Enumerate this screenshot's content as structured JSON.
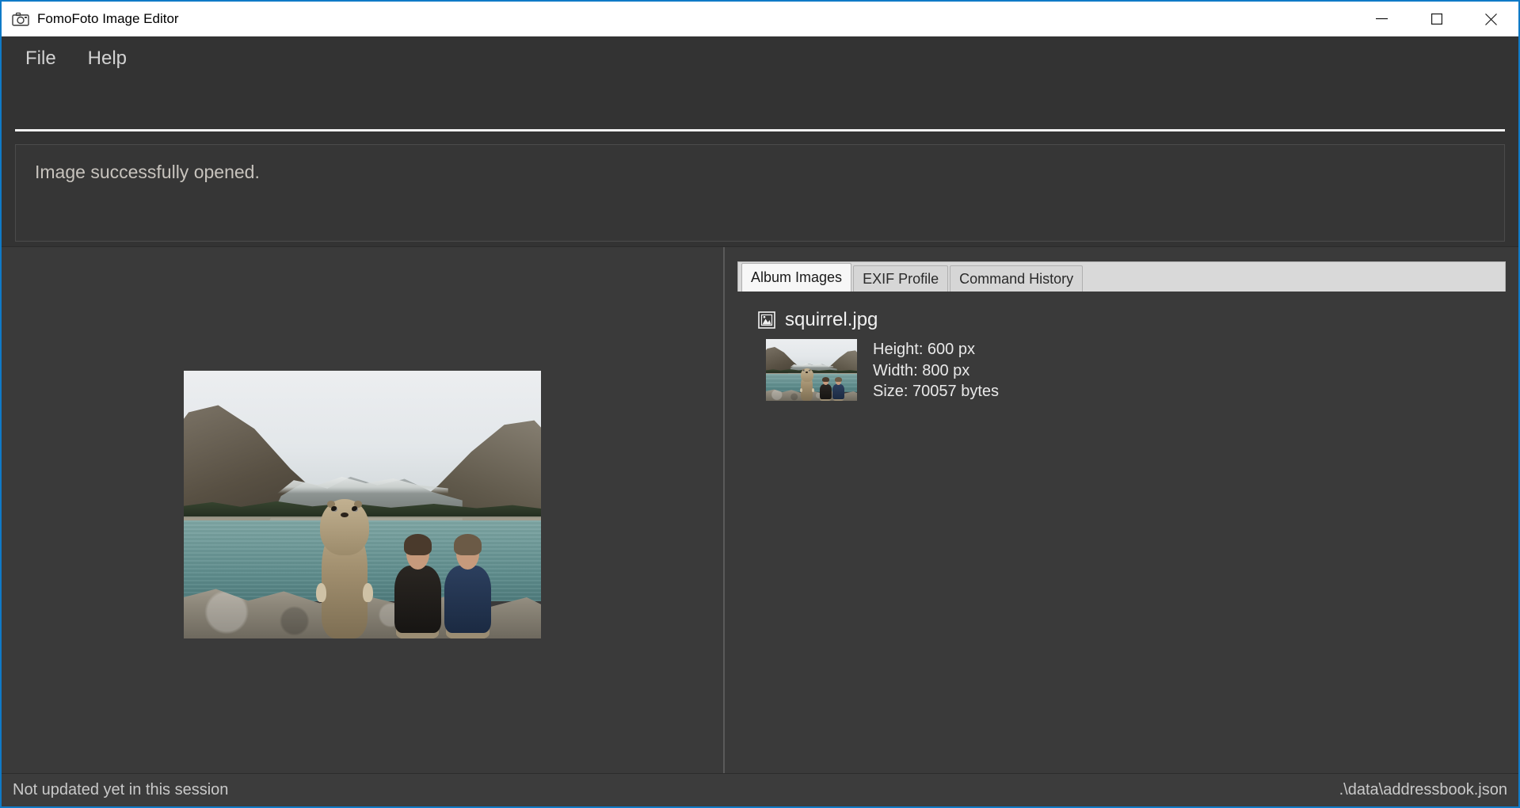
{
  "window": {
    "title": "FomoFoto Image Editor",
    "app_icon": "camera-icon",
    "accent_color": "#0f7ac7",
    "controls": {
      "minimize": "minimize-icon",
      "maximize": "maximize-icon",
      "close": "close-icon"
    }
  },
  "menubar": {
    "items": [
      {
        "label": "File"
      },
      {
        "label": "Help"
      }
    ]
  },
  "command": {
    "value": "",
    "placeholder": ""
  },
  "result": {
    "message": "Image successfully opened."
  },
  "preview": {
    "alt": "squirrel.jpg preview"
  },
  "tabs": [
    {
      "label": "Album Images",
      "active": true
    },
    {
      "label": "EXIF Profile",
      "active": false
    },
    {
      "label": "Command History",
      "active": false
    }
  ],
  "album": {
    "items": [
      {
        "icon": "picture-icon",
        "filename": "squirrel.jpg",
        "height": "Height: 600 px",
        "width": "Width: 800 px",
        "size": "Size: 70057 bytes"
      }
    ]
  },
  "statusbar": {
    "left": "Not updated yet in this session",
    "right": ".\\data\\addressbook.json"
  }
}
